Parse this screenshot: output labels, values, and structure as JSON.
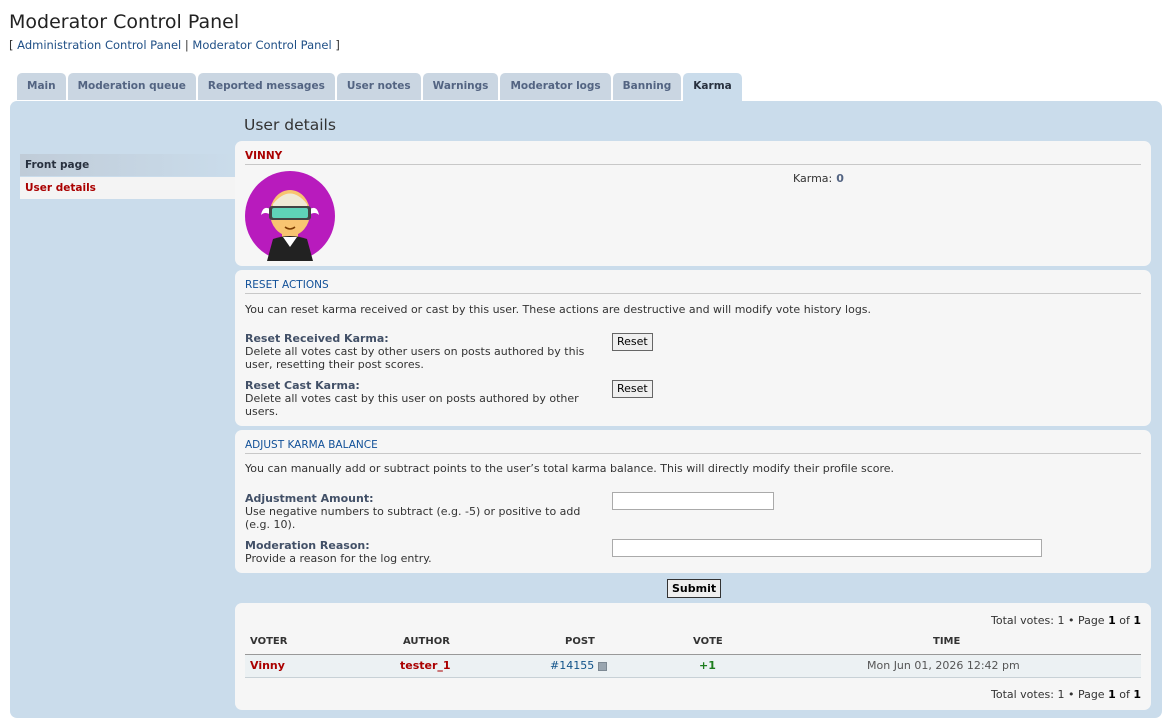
{
  "header": {
    "title": "Moderator Control Panel",
    "bracket_open": "[",
    "link_admin": "Administration Control Panel",
    "separator": "|",
    "link_mod": "Moderator Control Panel",
    "bracket_close": "]"
  },
  "tabs": [
    {
      "label": "Main"
    },
    {
      "label": "Moderation queue"
    },
    {
      "label": "Reported messages"
    },
    {
      "label": "User notes"
    },
    {
      "label": "Warnings"
    },
    {
      "label": "Moderator logs"
    },
    {
      "label": "Banning"
    },
    {
      "label": "Karma",
      "active": true
    }
  ],
  "sidebar": {
    "items": [
      {
        "label": "Front page"
      },
      {
        "label": "User details",
        "active": true
      }
    ]
  },
  "main": {
    "title": "User details"
  },
  "user": {
    "name": "VINNY",
    "karma_label": "Karma:",
    "karma_value": "0"
  },
  "reset": {
    "title": "RESET ACTIONS",
    "description": "You can reset karma received or cast by this user. These actions are destructive and will modify vote history logs.",
    "received_label": "Reset Received Karma:",
    "received_desc": "Delete all votes cast by other users on posts authored by this user, resetting their post scores.",
    "cast_label": "Reset Cast Karma:",
    "cast_desc": "Delete all votes cast by this user on posts authored by other users.",
    "button_label": "Reset"
  },
  "adjust": {
    "title": "ADJUST KARMA BALANCE",
    "description": "You can manually add or subtract points to the user’s total karma balance. This will directly modify their profile score.",
    "amount_label": "Adjustment Amount:",
    "amount_desc": "Use negative numbers to subtract (e.g. -5) or positive to add (e.g. 10).",
    "amount_value": "",
    "reason_label": "Moderation Reason:",
    "reason_desc": "Provide a reason for the log entry.",
    "reason_value": "",
    "submit_label": "Submit"
  },
  "votes": {
    "total_label": "Total votes:",
    "total": "1",
    "bullet": "•",
    "page_label": "Page",
    "page": "1",
    "of_label": "of",
    "pages": "1",
    "columns": [
      "VOTER",
      "AUTHOR",
      "POST",
      "VOTE",
      "TIME"
    ],
    "rows": [
      {
        "voter": "Vinny",
        "author": "tester_1",
        "post": "#14155",
        "vote": "+1",
        "time": "Mon Jun 01, 2026 12:42 pm"
      }
    ]
  },
  "colors": {
    "panel_bg": "#cadceb",
    "username": "#aa0000",
    "section_title": "#115098",
    "vote_positive": "#1c7c1c"
  }
}
